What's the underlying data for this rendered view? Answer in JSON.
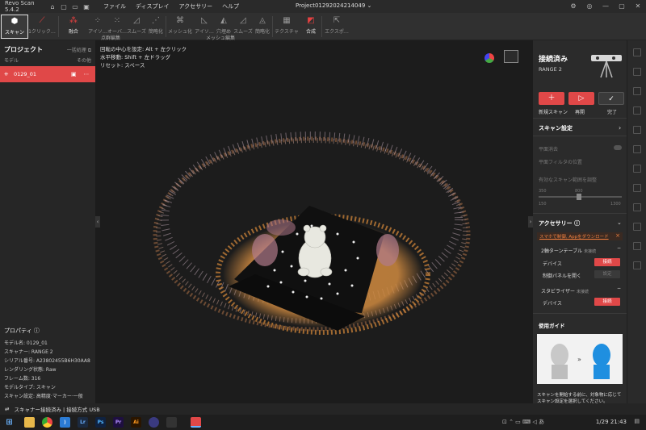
{
  "titlebar": {
    "app_name": "Revo Scan 5.4.2",
    "menu": [
      "ファイル",
      "ディスプレイ",
      "アクセサリー",
      "ヘルプ"
    ],
    "project_name": "Project01292024214049"
  },
  "toolbar": {
    "scan": "スキャン",
    "one_click": "1クリック…",
    "fuse": "融合",
    "isolate": "アイソ…",
    "overlap": "オーバ…",
    "smooth": "スムーズ",
    "simplify": "簡略化",
    "mesh": "メッシュ化",
    "isolate2": "アイソ…",
    "fill_holes": "穴埋め",
    "smooth2": "スムーズ",
    "simplify2": "簡略化",
    "texture": "テクスチャ",
    "merge": "合成",
    "export": "エクスポ…",
    "group_point_cloud": "点群編集",
    "group_mesh": "メッシュ編集"
  },
  "left_panel": {
    "title": "プロジェクト",
    "batch": "一括処理",
    "col_model": "モデル",
    "col_other": "その他",
    "model_name": "0129_01",
    "more": "⋯",
    "properties_title": "プロパティ",
    "properties": [
      "モデル名: 0129_01",
      "スキャナー: RANGE 2",
      "シリアル番号: A23802455B6H30AA8",
      "レンダリング状態: Raw",
      "フレーム数: 316",
      "モデルタイプ: スキャン",
      "スキャン設定: 高精度·マーカー·一般"
    ]
  },
  "viewport": {
    "hints": [
      "回転の中心を設定: Alt + 左クリック",
      "水平移動: Shift + 左ドラッグ",
      "リセット: スペース"
    ]
  },
  "right_panel": {
    "connected": "接続済み",
    "device": "RANGE 2",
    "new_scan": "新規スキャン",
    "resume": "再開",
    "done": "完了",
    "scan_settings": "スキャン設定",
    "plane_removal": "平面消去",
    "plane_filter": "平面フィルタの位置",
    "valid_range": "有効なスキャン範囲を調整",
    "range_min": "150",
    "range_mid": "800",
    "range_left": "350",
    "range_right": "1300",
    "accessories": "アクセサリー",
    "app_download": "スマホで制御, Appをダウンロード",
    "turntable": "2軸ターンテーブル",
    "not_connected": "未接続",
    "device_label": "デバイス",
    "connect": "接続",
    "control_panel": "制御パネルを開く",
    "setting": "設定",
    "stabilizer": "スタビライザー",
    "not_connected2": "未接続",
    "device_label2": "デバイス",
    "connect2": "接続",
    "guide": "使用ガイド",
    "guide_text": "スキャンを開始する前に、対象物に応じてスキャン設定を選択してください。"
  },
  "statusbar": {
    "text": "スキャナー接続済み | 接続方式 USB"
  },
  "taskbar": {
    "apps": [
      "Lr",
      "Ps",
      "Pr",
      "Ai"
    ],
    "time": "1/29 21:43"
  },
  "colors": {
    "accent": "#e04848",
    "orange": "#d98a3a"
  }
}
